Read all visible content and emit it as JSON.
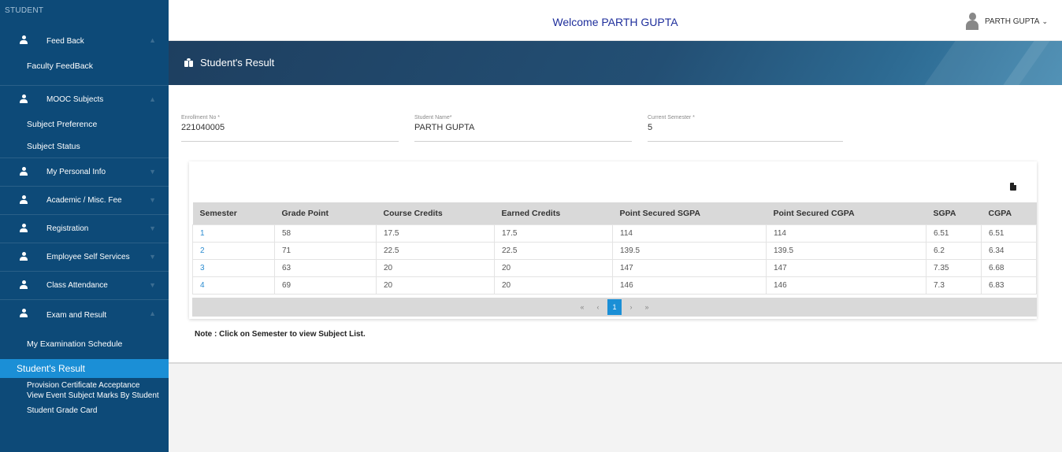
{
  "sidebar": {
    "header": "STUDENT",
    "groups": [
      {
        "label": "Feed Back",
        "items": [
          "Faculty FeedBack"
        ]
      },
      {
        "label": "MOOC Subjects",
        "items": [
          "Subject Preference",
          "Subject Status"
        ]
      },
      {
        "label": "My Personal Info"
      },
      {
        "label": "Academic / Misc. Fee"
      },
      {
        "label": "Registration"
      },
      {
        "label": "Employee Self Services"
      },
      {
        "label": "Class Attendance"
      },
      {
        "label": "Exam and Result",
        "items": [
          "My Examination Schedule"
        ]
      }
    ],
    "active_item": "Student's Result",
    "more_items": [
      "Provision Certificate Acceptance",
      "View Event Subject Marks By Student",
      "Student Grade Card"
    ]
  },
  "topbar": {
    "welcome": "Welcome PARTH GUPTA",
    "user_name": "PARTH GUPTA"
  },
  "banner": {
    "title": "Student's Result"
  },
  "form": {
    "enrollment": {
      "label": "Enrollment No *",
      "value": "221040005"
    },
    "student_name": {
      "label": "Student Name*",
      "value": "PARTH GUPTA"
    },
    "current_semester": {
      "label": "Current Semester *",
      "value": "5"
    }
  },
  "table": {
    "headers": [
      "Semester",
      "Grade Point",
      "Course Credits",
      "Earned Credits",
      "Point Secured SGPA",
      "Point Secured CGPA",
      "SGPA",
      "CGPA"
    ],
    "rows": [
      [
        "1",
        "58",
        "17.5",
        "17.5",
        "114",
        "114",
        "6.51",
        "6.51"
      ],
      [
        "2",
        "71",
        "22.5",
        "22.5",
        "139.5",
        "139.5",
        "6.2",
        "6.34"
      ],
      [
        "3",
        "63",
        "20",
        "20",
        "147",
        "147",
        "7.35",
        "6.68"
      ],
      [
        "4",
        "69",
        "20",
        "20",
        "146",
        "146",
        "7.3",
        "6.83"
      ]
    ]
  },
  "pager": {
    "first": "«",
    "prev": "‹",
    "current": "1",
    "next": "›",
    "last": "»"
  },
  "note": "Note : Click on Semester to view Subject List."
}
